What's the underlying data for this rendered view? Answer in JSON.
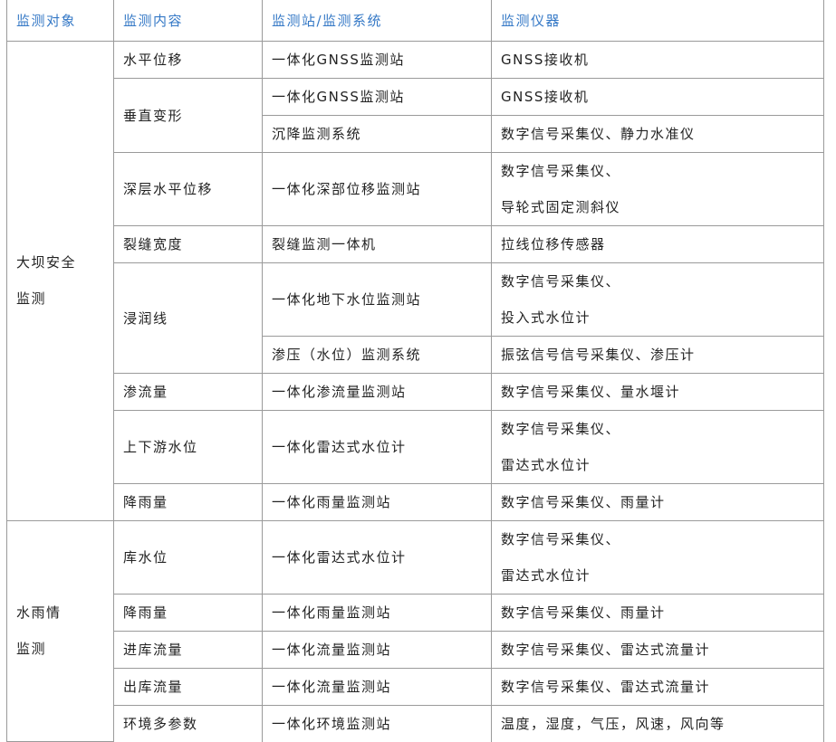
{
  "headers": [
    "监测对象",
    "监测内容",
    "监测站/监测系统",
    "监测仪器"
  ],
  "groups": [
    {
      "name": [
        "大坝安全",
        "监测"
      ],
      "items": [
        {
          "content": "水平位移",
          "rows": [
            {
              "station": "一体化GNSS监测站",
              "instrument": [
                "GNSS接收机"
              ]
            }
          ]
        },
        {
          "content": "垂直变形",
          "rows": [
            {
              "station": "一体化GNSS监测站",
              "instrument": [
                "GNSS接收机"
              ]
            },
            {
              "station": "沉降监测系统",
              "instrument": [
                "数字信号采集仪、静力水准仪"
              ]
            }
          ]
        },
        {
          "content": "深层水平位移",
          "rows": [
            {
              "station": "一体化深部位移监测站",
              "instrument": [
                "数字信号采集仪、",
                "导轮式固定测斜仪"
              ]
            }
          ]
        },
        {
          "content": "裂缝宽度",
          "rows": [
            {
              "station": "裂缝监测一体机",
              "instrument": [
                "拉线位移传感器"
              ]
            }
          ]
        },
        {
          "content": "浸润线",
          "rows": [
            {
              "station": "一体化地下水位监测站",
              "instrument": [
                "数字信号采集仪、",
                "投入式水位计"
              ]
            },
            {
              "station": "渗压（水位）监测系统",
              "instrument": [
                "振弦信号信号采集仪、渗压计"
              ]
            }
          ]
        },
        {
          "content": "渗流量",
          "rows": [
            {
              "station": "一体化渗流量监测站",
              "instrument": [
                "数字信号采集仪、量水堰计"
              ]
            }
          ]
        },
        {
          "content": "上下游水位",
          "rows": [
            {
              "station": "一体化雷达式水位计",
              "instrument": [
                "数字信号采集仪、",
                "雷达式水位计"
              ]
            }
          ]
        },
        {
          "content": "降雨量",
          "rows": [
            {
              "station": "一体化雨量监测站",
              "instrument": [
                "数字信号采集仪、雨量计"
              ]
            }
          ]
        }
      ]
    },
    {
      "name": [
        "水雨情",
        "监测"
      ],
      "items": [
        {
          "content": "库水位",
          "rows": [
            {
              "station": "一体化雷达式水位计",
              "instrument": [
                "数字信号采集仪、",
                "雷达式水位计"
              ]
            }
          ]
        },
        {
          "content": "降雨量",
          "rows": [
            {
              "station": "一体化雨量监测站",
              "instrument": [
                "数字信号采集仪、雨量计"
              ]
            }
          ]
        },
        {
          "content": "进库流量",
          "rows": [
            {
              "station": "一体化流量监测站",
              "instrument": [
                "数字信号采集仪、雷达式流量计"
              ]
            }
          ]
        },
        {
          "content": "出库流量",
          "rows": [
            {
              "station": "一体化流量监测站",
              "instrument": [
                "数字信号采集仪、雷达式流量计"
              ]
            }
          ]
        },
        {
          "content": "环境多参数",
          "rows": [
            {
              "station": "一体化环境监测站",
              "instrument": [
                "温度，湿度，气压，风速，风向等"
              ]
            }
          ]
        }
      ]
    }
  ]
}
